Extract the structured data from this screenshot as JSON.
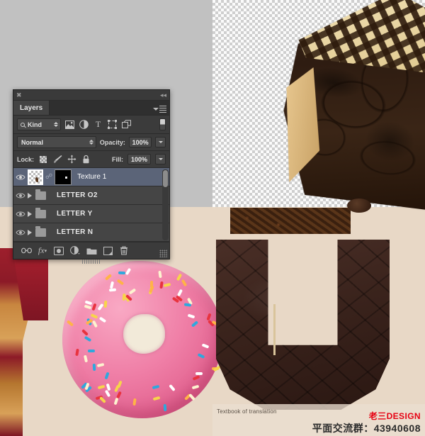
{
  "app": {
    "panel_title": "Layers",
    "close_icon": "close-icon",
    "collapse_icon": "collapse-arrows-icon",
    "menu_icon": "panel-menu-icon"
  },
  "filter": {
    "kind_label": "Kind",
    "search_icon": "search-icon",
    "icons": [
      {
        "name": "pixel-layer-filter-icon",
        "glyph": "▣"
      },
      {
        "name": "adjustment-layer-filter-icon",
        "glyph": "◑"
      },
      {
        "name": "type-layer-filter-icon",
        "glyph": "T"
      },
      {
        "name": "shape-layer-filter-icon",
        "glyph": "⬚"
      },
      {
        "name": "smart-object-filter-icon",
        "glyph": "❐"
      }
    ],
    "toggle_name": "filter-enable-toggle"
  },
  "blend": {
    "mode": "Normal",
    "opacity_label": "Opacity:",
    "opacity_value": "100%"
  },
  "lock": {
    "label": "Lock:",
    "fill_label": "Fill:",
    "fill_value": "100%",
    "icons": [
      {
        "name": "lock-transparent-pixels-icon",
        "glyph": ""
      },
      {
        "name": "lock-image-pixels-brush-icon",
        "glyph": "🖌"
      },
      {
        "name": "lock-position-move-icon",
        "glyph": "✥"
      },
      {
        "name": "lock-all-padlock-icon",
        "glyph": "🔒"
      }
    ]
  },
  "layers": [
    {
      "name": "Texture 1",
      "type": "pixel",
      "selected": true,
      "visible": true,
      "has_mask": true,
      "linked": true
    },
    {
      "name": "LETTER O2",
      "type": "group",
      "selected": false,
      "visible": true,
      "expanded": false
    },
    {
      "name": "LETTER Y",
      "type": "group",
      "selected": false,
      "visible": true,
      "expanded": false
    },
    {
      "name": "LETTER N",
      "type": "group",
      "selected": false,
      "visible": true,
      "expanded": false
    }
  ],
  "footer_tools": [
    {
      "name": "link-layers-icon",
      "glyph": "⚭"
    },
    {
      "name": "layer-style-fx-icon",
      "glyph": "fx"
    },
    {
      "name": "add-layer-mask-icon",
      "glyph": "▣"
    },
    {
      "name": "new-adjustment-layer-icon",
      "glyph": "◐"
    },
    {
      "name": "new-group-icon",
      "glyph": "🗀"
    },
    {
      "name": "new-layer-icon",
      "glyph": "❐"
    },
    {
      "name": "delete-layer-icon",
      "glyph": "🗑"
    }
  ],
  "watermark": {
    "translation_note": "Textbook of translation",
    "brand": "老三DESIGN",
    "qq_group": "平面交流群：43940608",
    "brand_color": "#e60012"
  },
  "canvas": {
    "background_color": "#c1c1c1",
    "paper_color": "#e8d8c6",
    "artwork_description": "chocolate cake slice, pink sprinkle donut, chocolate letter U"
  }
}
